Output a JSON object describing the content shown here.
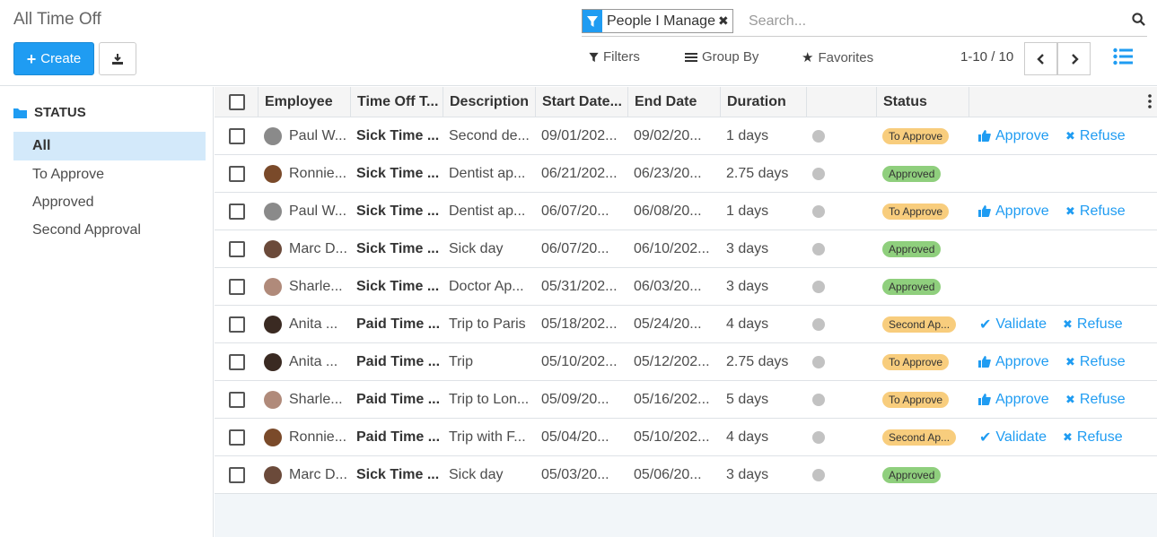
{
  "breadcrumb": "All Time Off",
  "buttons": {
    "create": "Create"
  },
  "search": {
    "facet": "People I Manage",
    "placeholder": "Search..."
  },
  "filters": {
    "filters": "Filters",
    "group_by": "Group By",
    "favorites": "Favorites"
  },
  "pager": {
    "value": "1-10 / 10"
  },
  "sidebar": {
    "heading": "STATUS",
    "items": [
      {
        "label": "All",
        "active": true
      },
      {
        "label": "To Approve"
      },
      {
        "label": "Approved"
      },
      {
        "label": "Second Approval"
      }
    ]
  },
  "table": {
    "columns": [
      "Employee",
      "Time Off T...",
      "Description",
      "Start Date...",
      "End Date",
      "Duration",
      "",
      "Status"
    ],
    "rows": [
      {
        "employee": "Paul W...",
        "type": "Sick Time ...",
        "description": "Second de...",
        "start": "09/01/202...",
        "end": "09/02/20...",
        "duration": "1 days",
        "status": "To Approve",
        "status_kind": "toapprove",
        "action": "Approve",
        "refuse": "Refuse",
        "avatar": "#8a8a8a"
      },
      {
        "employee": "Ronnie...",
        "type": "Sick Time ...",
        "description": "Dentist ap...",
        "start": "06/21/202...",
        "end": "06/23/20...",
        "duration": "2.75 days",
        "status": "Approved",
        "status_kind": "approved",
        "action": "",
        "refuse": "",
        "avatar": "#7a4a2a"
      },
      {
        "employee": "Paul W...",
        "type": "Sick Time ...",
        "description": "Dentist ap...",
        "start": "06/07/20...",
        "end": "06/08/20...",
        "duration": "1 days",
        "status": "To Approve",
        "status_kind": "toapprove",
        "action": "Approve",
        "refuse": "Refuse",
        "avatar": "#8a8a8a"
      },
      {
        "employee": "Marc D...",
        "type": "Sick Time ...",
        "description": "Sick day",
        "start": "06/07/20...",
        "end": "06/10/202...",
        "duration": "3 days",
        "status": "Approved",
        "status_kind": "approved",
        "action": "",
        "refuse": "",
        "avatar": "#6b4a3a"
      },
      {
        "employee": "Sharle...",
        "type": "Sick Time ...",
        "description": "Doctor Ap...",
        "start": "05/31/202...",
        "end": "06/03/20...",
        "duration": "3 days",
        "status": "Approved",
        "status_kind": "approved",
        "action": "",
        "refuse": "",
        "avatar": "#b08a7a"
      },
      {
        "employee": "Anita ...",
        "type": "Paid Time ...",
        "description": "Trip to Paris",
        "start": "05/18/202...",
        "end": "05/24/20...",
        "duration": "4 days",
        "status": "Second Ap...",
        "status_kind": "toapprove",
        "action": "Validate",
        "refuse": "Refuse",
        "avatar": "#3a2a22"
      },
      {
        "employee": "Anita ...",
        "type": "Paid Time ...",
        "description": "Trip",
        "start": "05/10/202...",
        "end": "05/12/202...",
        "duration": "2.75 days",
        "status": "To Approve",
        "status_kind": "toapprove",
        "action": "Approve",
        "refuse": "Refuse",
        "avatar": "#3a2a22"
      },
      {
        "employee": "Sharle...",
        "type": "Paid Time ...",
        "description": "Trip to Lon...",
        "start": "05/09/20...",
        "end": "05/16/202...",
        "duration": "5 days",
        "status": "To Approve",
        "status_kind": "toapprove",
        "action": "Approve",
        "refuse": "Refuse",
        "avatar": "#b08a7a"
      },
      {
        "employee": "Ronnie...",
        "type": "Paid Time ...",
        "description": "Trip with F...",
        "start": "05/04/20...",
        "end": "05/10/202...",
        "duration": "4 days",
        "status": "Second Ap...",
        "status_kind": "toapprove",
        "action": "Validate",
        "refuse": "Refuse",
        "avatar": "#7a4a2a"
      },
      {
        "employee": "Marc D...",
        "type": "Sick Time ...",
        "description": "Sick day",
        "start": "05/03/20...",
        "end": "05/06/20...",
        "duration": "3 days",
        "status": "Approved",
        "status_kind": "approved",
        "action": "",
        "refuse": "",
        "avatar": "#6b4a3a"
      }
    ]
  },
  "colors": {
    "primary": "#1f9cf2",
    "approved": "#8fcf7d",
    "to_approve": "#f8cd7d",
    "selected": "#d3e9fa"
  }
}
